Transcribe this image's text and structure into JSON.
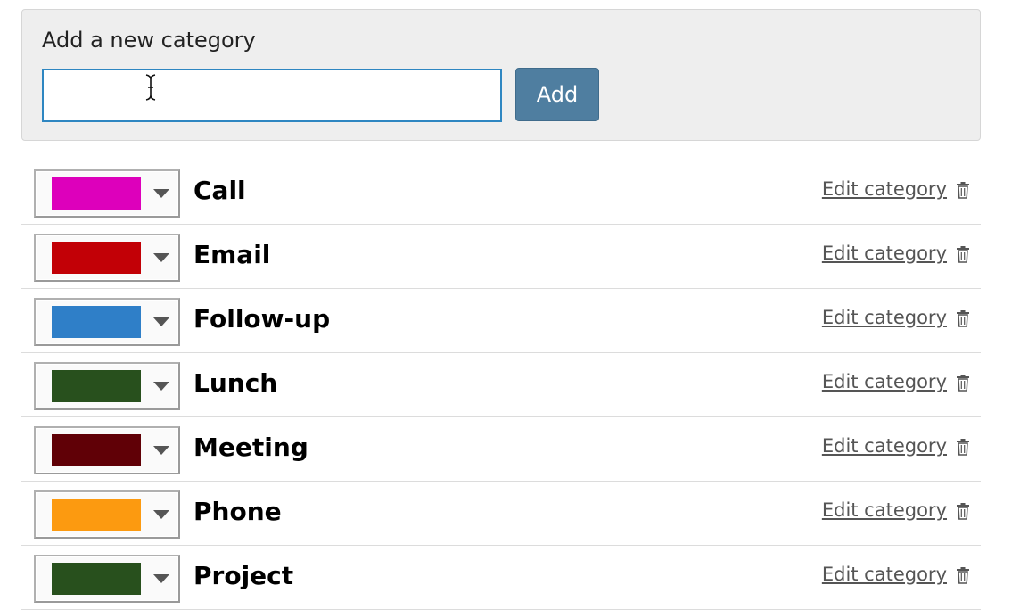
{
  "add_panel": {
    "label": "Add a new category",
    "input_value": "",
    "input_placeholder": "",
    "add_button_label": "Add"
  },
  "categories": [
    {
      "name": "Call",
      "color": "#dd00bb",
      "edit_label": "Edit category"
    },
    {
      "name": "Email",
      "color": "#c20006",
      "edit_label": "Edit category"
    },
    {
      "name": "Follow-up",
      "color": "#2f7fc8",
      "edit_label": "Edit category"
    },
    {
      "name": "Lunch",
      "color": "#28501d",
      "edit_label": "Edit category"
    },
    {
      "name": "Meeting",
      "color": "#600006",
      "edit_label": "Edit category"
    },
    {
      "name": "Phone",
      "color": "#fc9a10",
      "edit_label": "Edit category"
    },
    {
      "name": "Project",
      "color": "#28501d",
      "edit_label": "Edit category"
    }
  ],
  "icons": {
    "dropdown": "chevron-down-icon",
    "delete": "trash-icon",
    "cursor": "text-cursor-icon"
  }
}
